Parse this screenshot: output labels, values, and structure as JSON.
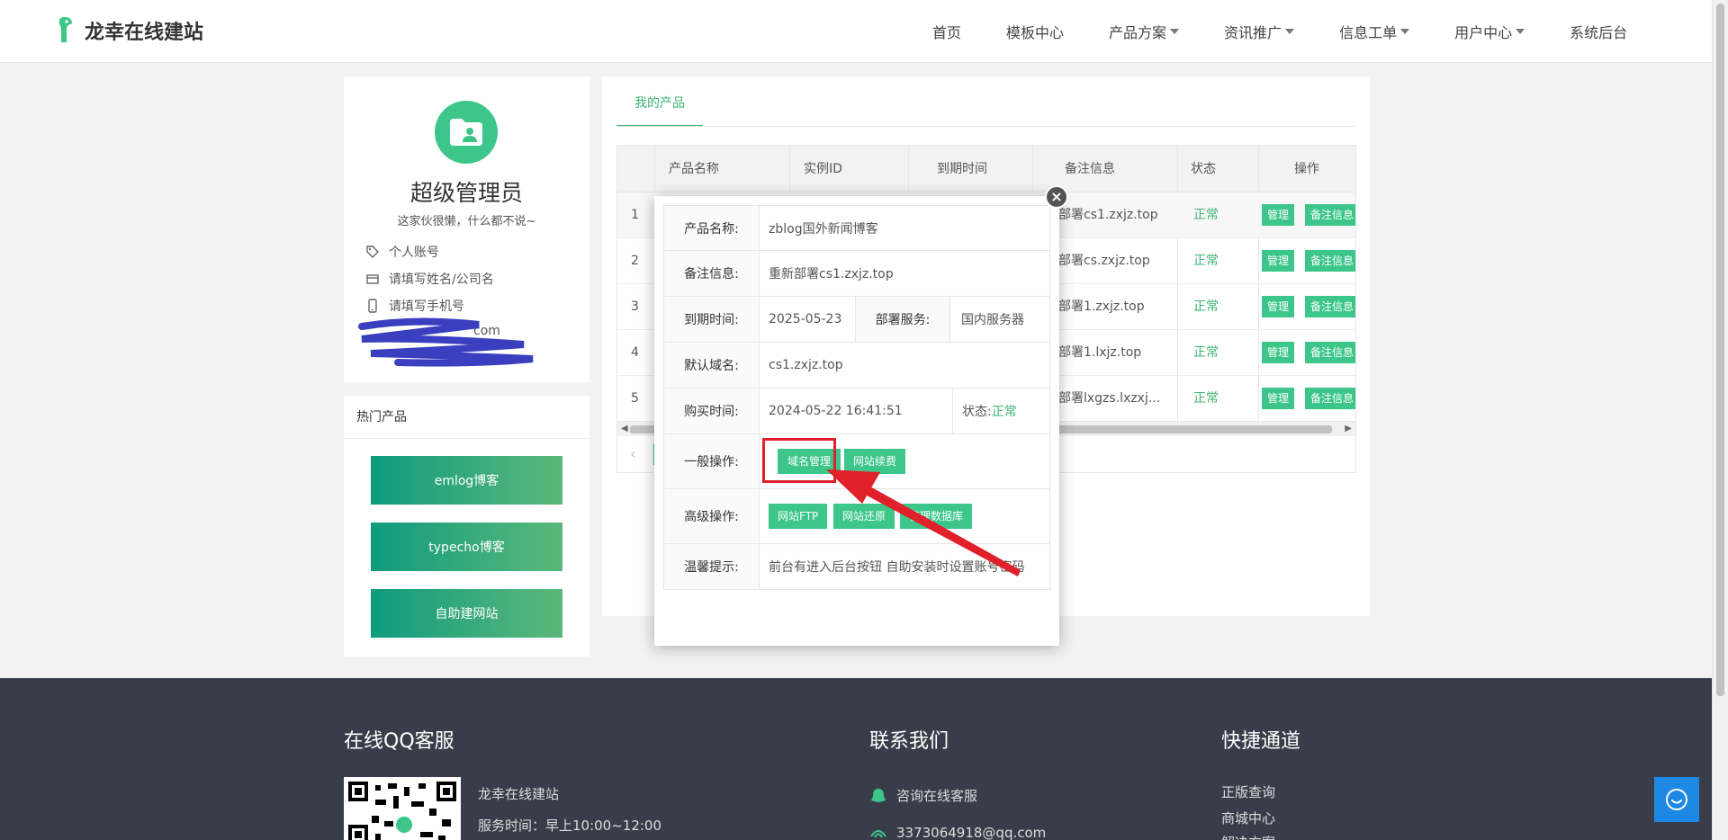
{
  "header": {
    "site_name": "龙幸在线建站",
    "nav": [
      {
        "label": "首页",
        "dropdown": false
      },
      {
        "label": "模板中心",
        "dropdown": false
      },
      {
        "label": "产品方案",
        "dropdown": true
      },
      {
        "label": "资讯推广",
        "dropdown": true
      },
      {
        "label": "信息工单",
        "dropdown": true
      },
      {
        "label": "用户中心",
        "dropdown": true
      },
      {
        "label": "系统后台",
        "dropdown": false
      }
    ]
  },
  "profile": {
    "name": "超级管理员",
    "signature": "这家伙很懒，什么都不说~",
    "account_label": "个人账号",
    "name_placeholder": "请填写姓名/公司名",
    "phone_placeholder": "请填写手机号",
    "email_partial": "com"
  },
  "hot_products": {
    "title": "热门产品",
    "items": [
      "emlog博客",
      "typecho博客",
      "自助建网站"
    ]
  },
  "main": {
    "tab_label": "我的产品",
    "columns": [
      "产品名称",
      "实例ID",
      "到期时间",
      "备注信息",
      "状态",
      "操作"
    ],
    "rows": [
      {
        "index": "1",
        "remark": "部署cs1.zxjz.top",
        "status": "正常"
      },
      {
        "index": "2",
        "remark": "部署cs.zxjz.top",
        "status": "正常"
      },
      {
        "index": "3",
        "remark": "部署1.zxjz.top",
        "status": "正常"
      },
      {
        "index": "4",
        "remark": "部署1.lxjz.top",
        "status": "正常"
      },
      {
        "index": "5",
        "remark": "部署lxgzs.lxzxj...",
        "status": "正常"
      }
    ],
    "manage_label": "管理",
    "remark_btn_label": "备注信息"
  },
  "modal": {
    "product_name_label": "产品名称:",
    "product_name": "zblog国外新闻博客",
    "remark_label": "备注信息:",
    "remark": "重新部署cs1.zxjz.top",
    "expire_label": "到期时间:",
    "expire": "2025-05-23",
    "deploy_label": "部署服务:",
    "deploy": "国内服务器",
    "domain_label": "默认域名:",
    "domain": "cs1.zxjz.top",
    "buy_label": "购买时间:",
    "buy_time": "2024-05-22 16:41:51",
    "status_label": "状态:",
    "status": "正常",
    "general_ops_label": "一般操作:",
    "domain_manage": "域名管理",
    "site_renew": "网站续费",
    "advanced_ops_label": "高级操作:",
    "site_ftp": "网站FTP",
    "site_restore": "网站还原",
    "db_manage": "管理数据库",
    "tip_label": "温馨提示:",
    "tip": "前台有进入后台按钮 自助安装时设置账号密码",
    "close": "×"
  },
  "footer": {
    "qq_title": "在线QQ客服",
    "qq_name": "龙幸在线建站",
    "service_time": "服务时间：早上10:00~12:00",
    "contact_title": "联系我们",
    "contact_online": "咨询在线客服",
    "contact_email": "3373064918@qq.com",
    "quick_title": "快捷通道",
    "quick_links": [
      "正版查询",
      "商城中心",
      "解决方案"
    ]
  },
  "colors": {
    "accent": "#3cc68a",
    "footer_bg": "#393d49",
    "annotation": "#e0202a"
  }
}
